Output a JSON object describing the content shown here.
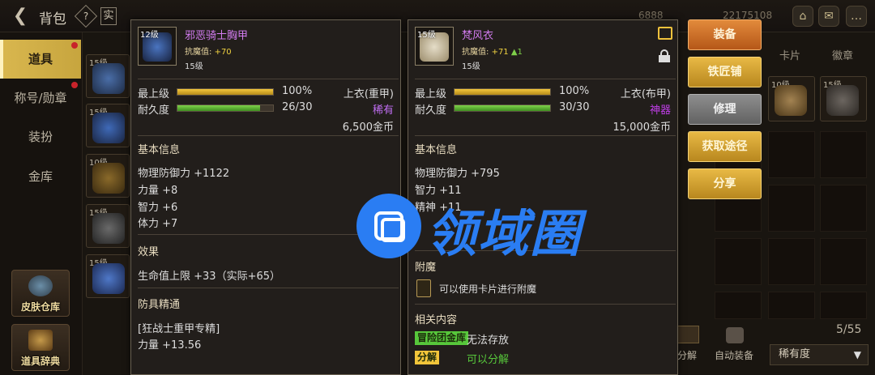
{
  "topbar": {
    "title": "背包",
    "help_glyph": "?",
    "frame_glyph": "实",
    "faded_currency": "6888",
    "faded_gold": "22175108"
  },
  "nav": {
    "items": [
      {
        "label": "道具"
      },
      {
        "label": "称号/勋章"
      },
      {
        "label": "装扮"
      },
      {
        "label": "金库"
      }
    ],
    "tools": [
      {
        "label": "皮肤仓库"
      },
      {
        "label": "道具辞典"
      }
    ]
  },
  "inventory": {
    "slots": [
      {
        "level": "15级"
      },
      {
        "level": "15级"
      },
      {
        "level": "10级"
      },
      {
        "level": "15级"
      },
      {
        "level": "15级"
      }
    ],
    "right_tabs": [
      "卡片",
      "徽章"
    ],
    "right_slots": [
      {
        "level": "10级"
      },
      {
        "level": "15级"
      }
    ],
    "count": "5/55",
    "sort_label": "稀有度",
    "auto_equip": "自动装备",
    "decompose": "分解"
  },
  "tooltip_left": {
    "icon_level": "12级",
    "name": "邪恶骑士胸甲",
    "resist_label": "抗魔值:",
    "resist_value": "+70",
    "level": "15级",
    "grade_label": "最上级",
    "grade_value": "100%",
    "grade_pct": 1.0,
    "durability_label": "耐久度",
    "durability_value": "26/30",
    "durability_pct": 0.867,
    "slot_type": "上衣(重甲)",
    "rarity": "稀有",
    "price": "6,500金币",
    "basic_title": "基本信息",
    "stats": [
      "物理防御力 +1122",
      "力量 +8",
      "智力 +6",
      "体力 +7"
    ],
    "effect_title": "效果",
    "effect": "生命值上限 +33（实际+65）",
    "mastery_title": "防具精通",
    "mastery_name": "[狂战士重甲专精]",
    "mastery_stat": "力量 +13.56"
  },
  "tooltip_right": {
    "icon_level": "15级",
    "name": "梵风衣",
    "resist_label": "抗魔值:",
    "resist_value": "+71",
    "resist_delta": "▲1",
    "level": "15级",
    "grade_label": "最上级",
    "grade_value": "100%",
    "grade_pct": 1.0,
    "durability_label": "耐久度",
    "durability_value": "30/30",
    "durability_pct": 1.0,
    "slot_type": "上衣(布甲)",
    "rarity": "神器",
    "price": "15,000金币",
    "basic_title": "基本信息",
    "stats": [
      "物理防御力 +795",
      "智力 +11",
      "精神 +11"
    ],
    "enchant_title": "附魔",
    "enchant_text": "可以使用卡片进行附魔",
    "related_title": "相关内容",
    "tag1": "冒险团金库",
    "tag1_text": "无法存放",
    "tag2": "分解",
    "tag2_text": "可以分解"
  },
  "actions": {
    "equip": "装备",
    "smith": "铁匠铺",
    "repair": "修理",
    "obtain": "获取途径",
    "share": "分享"
  },
  "watermark": {
    "text": "领域圈"
  },
  "colors": {
    "gold_accent": "#d9b74f",
    "epic_purple": "#d37cf0",
    "green_bar": "#7fd34a",
    "watermark_blue": "#2a7df3"
  }
}
